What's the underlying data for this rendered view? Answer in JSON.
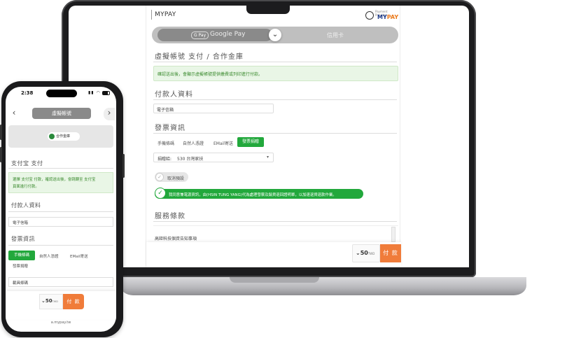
{
  "colors": {
    "accent_green": "#22a83c",
    "pay_orange": "#f07c3a",
    "note_bg": "#e9f6e6",
    "brand_blue": "#1e3a8a"
  },
  "laptop": {
    "brand": "MYPAY",
    "logo": {
      "small_text": "Payment Provider",
      "name_part1": "MY",
      "name_part2": "PAY"
    },
    "tabs": {
      "gpay_badge": "G Pay",
      "google_pay": "Google Pay",
      "credit_card": "信用卡",
      "chevron": "⌄"
    },
    "section_virtual": "虛擬帳號 支付 / 合作金庫",
    "note": "確認送出後，會顯示虛擬帳號提供繳費或列印進行付款。",
    "section_payer": "付款人資料",
    "email_label": "電子信箱",
    "section_invoice": "發票資訊",
    "invoice_tabs": [
      "手機條碼",
      "自然人憑證",
      "EMail寄送",
      "發票捐贈"
    ],
    "donate_label": "捐贈給:",
    "donate_value": "530 台灣家扶",
    "cancel_default": "取消預設",
    "agree_text": "我同意兼電源資訊，由(HSIN TUNG YANG)代為處理發票及銷貨退回證明單，以加速退貨退款作業。",
    "section_terms": "服務條款",
    "terms_text": "高鉅科技個資告知事項",
    "amount": "50",
    "currency": "TWD",
    "pay_button": "付 款"
  },
  "phone": {
    "time": "2:38",
    "status_icons": "▮▮ ◠",
    "tab_label": "虛擬帳號",
    "bank_label": "合作金庫",
    "section_alipay": "支付宝 支付",
    "note_line1": "選擇 支付宝 付款，確認送出後，會跳轉至 支付宝",
    "note_line2": "頁面進行付款。",
    "section_payer": "付款人資料",
    "email_label": "電子信箱",
    "section_invoice": "發票資訊",
    "invoice_tabs": [
      "手機條碼",
      "自然人憑證",
      "EMail寄送",
      "發票捐贈"
    ],
    "carrier_label": "載具條碼",
    "amount": "50",
    "currency": "TWD",
    "pay_button": "付 款",
    "url": "a.mypay.tw",
    "left_arrow": "‹",
    "right_arrow": "›"
  }
}
